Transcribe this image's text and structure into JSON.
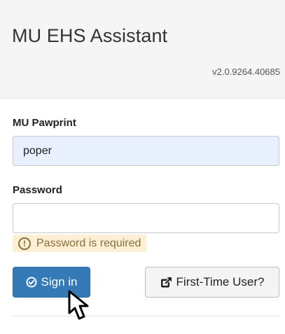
{
  "header": {
    "title": "MU EHS Assistant",
    "version": "v2.0.9264.40685"
  },
  "form": {
    "username_label": "MU Pawprint",
    "username_value": "poper",
    "password_label": "Password",
    "password_value": "",
    "password_error": "Password is required"
  },
  "actions": {
    "signin_label": "Sign in",
    "first_time_label": "First-Time User?"
  },
  "icons": {
    "error": "exclamation-circle-icon",
    "signin": "check-circle-icon",
    "first_time": "external-link-icon",
    "cursor": "pointer-cursor-icon"
  },
  "colors": {
    "primary": "#337ab7",
    "autofill_bg": "#e8f0fe",
    "warning_bg": "#fcefd4",
    "warning_text": "#8a6d3b"
  }
}
